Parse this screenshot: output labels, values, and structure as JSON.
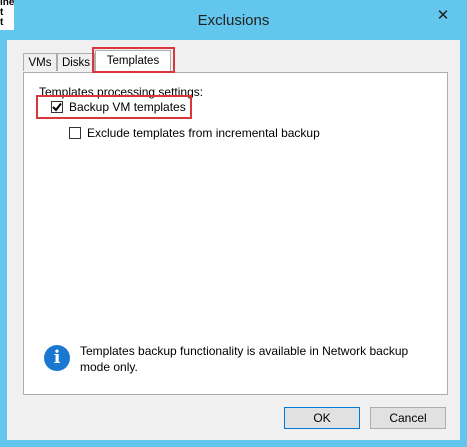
{
  "window": {
    "title": "Exclusions",
    "close_glyph": "✕"
  },
  "background": {
    "fragment_lines": [
      "ines",
      "t",
      "t"
    ]
  },
  "tabs": [
    {
      "label": "VMs",
      "active": false
    },
    {
      "label": "Disks",
      "active": false
    },
    {
      "label": "Templates",
      "active": true
    }
  ],
  "templates_panel": {
    "section_label": "Templates processing settings:",
    "backup_vm_templates": {
      "label": "Backup VM templates",
      "checked": true
    },
    "exclude_incremental": {
      "label": "Exclude templates from incremental backup",
      "checked": false
    }
  },
  "info": {
    "icon": "info-icon",
    "text": "Templates backup functionality is available in Network backup mode only."
  },
  "buttons": {
    "ok": "OK",
    "cancel": "Cancel"
  },
  "colors": {
    "window_frame": "#63c6ec",
    "highlight": "#d9373b",
    "info_icon": "#1a78d0",
    "default_button_border": "#0078d7"
  }
}
